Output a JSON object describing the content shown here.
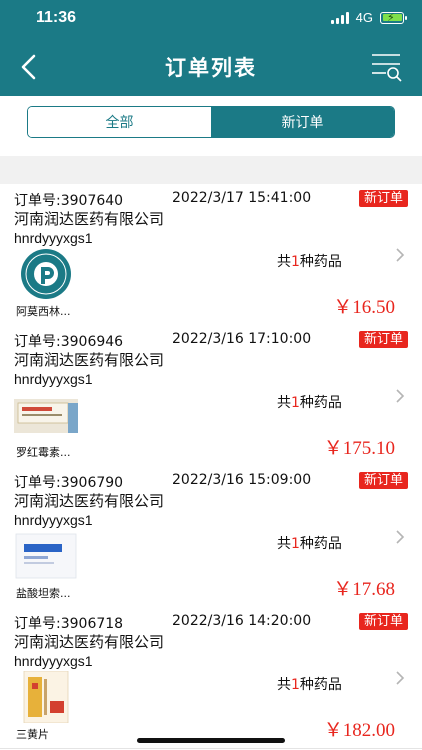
{
  "status_bar": {
    "time": "11:36",
    "network": "4G"
  },
  "nav": {
    "title": "订单列表"
  },
  "tabs": [
    {
      "label": "全部",
      "selected": false
    },
    {
      "label": "新订单",
      "selected": true
    }
  ],
  "orders": [
    {
      "order_no": "订单号:3907640",
      "datetime": "2022/3/17 15:41:00",
      "badge": "新订单",
      "company": "河南润达医药有限公司",
      "account": "hnrdyyyxgs1",
      "count_prefix": "共",
      "count_num": "1",
      "count_suffix": "种药品",
      "product_name": "阿莫西林...",
      "price": "￥16.50"
    },
    {
      "order_no": "订单号:3906946",
      "datetime": "2022/3/16 17:10:00",
      "badge": "新订单",
      "company": "河南润达医药有限公司",
      "account": "hnrdyyyxgs1",
      "count_prefix": "共",
      "count_num": "1",
      "count_suffix": "种药品",
      "product_name": "罗红霉素...",
      "price": "￥175.10"
    },
    {
      "order_no": "订单号:3906790",
      "datetime": "2022/3/16 15:09:00",
      "badge": "新订单",
      "company": "河南润达医药有限公司",
      "account": "hnrdyyyxgs1",
      "count_prefix": "共",
      "count_num": "1",
      "count_suffix": "种药品",
      "product_name": "盐酸坦索...",
      "price": "￥17.68"
    },
    {
      "order_no": "订单号:3906718",
      "datetime": "2022/3/16 14:20:00",
      "badge": "新订单",
      "company": "河南润达医药有限公司",
      "account": "hnrdyyyxgs1",
      "count_prefix": "共",
      "count_num": "1",
      "count_suffix": "种药品",
      "product_name": "三黄片",
      "price": "￥182.00"
    }
  ],
  "colors": {
    "primary": "#1b7a86",
    "accent_red": "#e8261e",
    "divider": "#f1f1f1"
  },
  "icons": [
    "back-arrow-icon",
    "filter-search-icon",
    "chevron-right-icon",
    "signal-icon",
    "battery-icon"
  ]
}
